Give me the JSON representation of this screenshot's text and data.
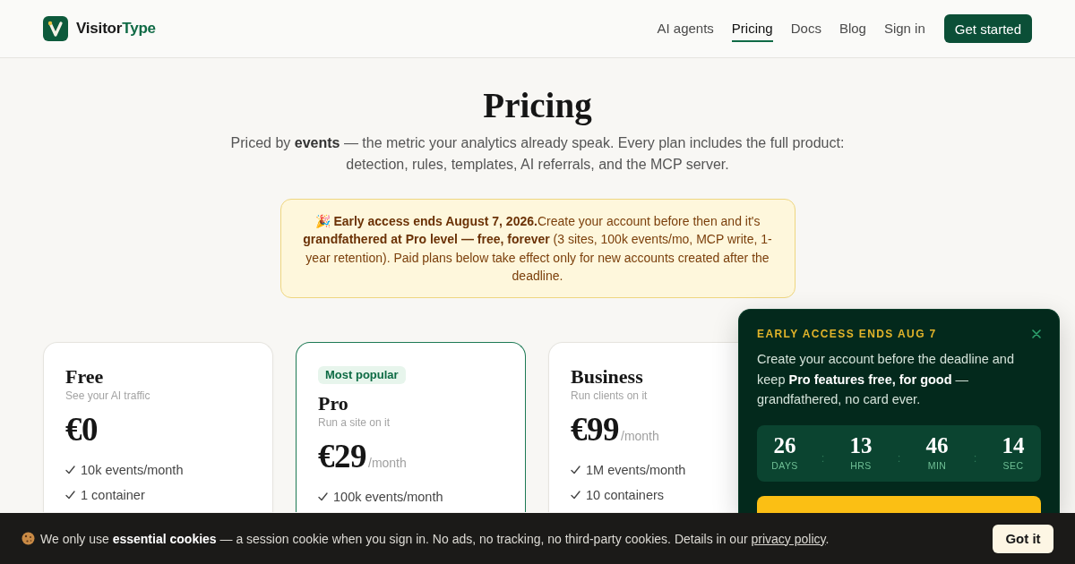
{
  "header": {
    "brand": {
      "name": "Visitor",
      "accent": "Type"
    },
    "nav": [
      {
        "label": "AI agents",
        "selected": false
      },
      {
        "label": "Pricing",
        "selected": true
      },
      {
        "label": "Docs",
        "selected": false
      },
      {
        "label": "Blog",
        "selected": false
      },
      {
        "label": "Sign in",
        "selected": false
      }
    ],
    "cta": "Get started"
  },
  "hero": {
    "title": "Pricing",
    "subtitle": "Priced by **events** — the metric your analytics already speak. Every plan includes the full product: detection, rules, templates, AI referrals, and the MCP server."
  },
  "notice": {
    "text": "🎉 **Early access ends August 7, 2026.**Create your account before then and it's **grandfathered at Pro level — free, forever** (3 sites, 100k events/mo, MCP write, 1-year retention). Paid plans below take effect only for new accounts created after the deadline."
  },
  "plans": [
    {
      "name": "Free",
      "tagline": "See your AI traffic",
      "price": "€0",
      "highlighted": false,
      "features": [
        "10k events/month",
        "1 container"
      ]
    },
    {
      "badge": "Most popular",
      "name": "Pro",
      "tagline": "Run a site on it",
      "price": "€29",
      "period": "/month",
      "highlighted": true,
      "features": [
        "100k events/month"
      ]
    },
    {
      "name": "Business",
      "tagline": "Run clients on it",
      "price": "€99",
      "period": "/month",
      "highlighted": false,
      "features": [
        "1M events/month",
        "10 containers"
      ]
    }
  ],
  "promo": {
    "eyebrow": "EARLY ACCESS ENDS AUG 7",
    "body": "Create your account before the deadline and keep **Pro features free, for good** — grandfathered, no card ever.",
    "countdown": [
      {
        "value": "26",
        "label": "DAYS"
      },
      {
        "value": "13",
        "label": "HRS"
      },
      {
        "value": "46",
        "label": "MIN"
      },
      {
        "value": "14",
        "label": "SEC"
      }
    ],
    "separator": ":"
  },
  "cookie_banner": {
    "text": "We only use **essential cookies** — a session cookie when you sign in. No ads, no tracking, no third-party cookies. Details in our",
    "link": "privacy policy",
    "end": ".",
    "button": "Got it"
  }
}
